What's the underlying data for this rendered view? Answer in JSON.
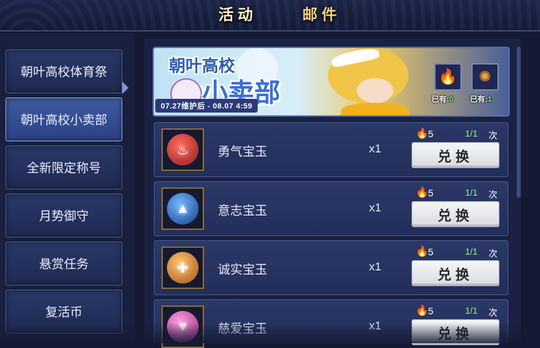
{
  "tabs": [
    {
      "label": "活动",
      "active": true
    },
    {
      "label": "邮件",
      "active": false
    }
  ],
  "sidebar": {
    "items": [
      {
        "label": "朝叶高校体育祭",
        "active": false
      },
      {
        "label": "朝叶高校小卖部",
        "active": true
      },
      {
        "label": "全新限定称号",
        "active": false
      },
      {
        "label": "月势御守",
        "active": false
      },
      {
        "label": "悬赏任务",
        "active": false
      },
      {
        "label": "复活币",
        "active": false
      }
    ]
  },
  "banner": {
    "title_line1": "朝叶高校",
    "title_line2": "小卖部",
    "date_range": "07.27维护后 - 08.07 4:59",
    "owned": [
      {
        "label": "已有:",
        "count": "0",
        "icon": "torch-icon"
      },
      {
        "label": "已有:",
        "count": "1",
        "icon": "firework-icon"
      }
    ]
  },
  "exchange": {
    "button_label": "兑换",
    "limit_unit": "次",
    "rows": [
      {
        "name": "勇气宝玉",
        "qty": "x1",
        "cost": "5",
        "limit": "1/1",
        "gem_color": "#c23a3a",
        "gem_icon": "flame-icon",
        "glyph": "♨"
      },
      {
        "name": "意志宝玉",
        "qty": "x1",
        "cost": "5",
        "limit": "1/1",
        "gem_color": "#2f78d0",
        "gem_icon": "triangle-icon",
        "glyph": "▲"
      },
      {
        "name": "诚实宝玉",
        "qty": "x1",
        "cost": "5",
        "limit": "1/1",
        "gem_color": "#d98a2e",
        "gem_icon": "cross-icon",
        "glyph": "✚"
      },
      {
        "name": "慈爱宝玉",
        "qty": "x1",
        "cost": "5",
        "limit": "1/1",
        "gem_color": "#d65bb6",
        "gem_icon": "heart-icon",
        "glyph": "♥"
      }
    ]
  }
}
